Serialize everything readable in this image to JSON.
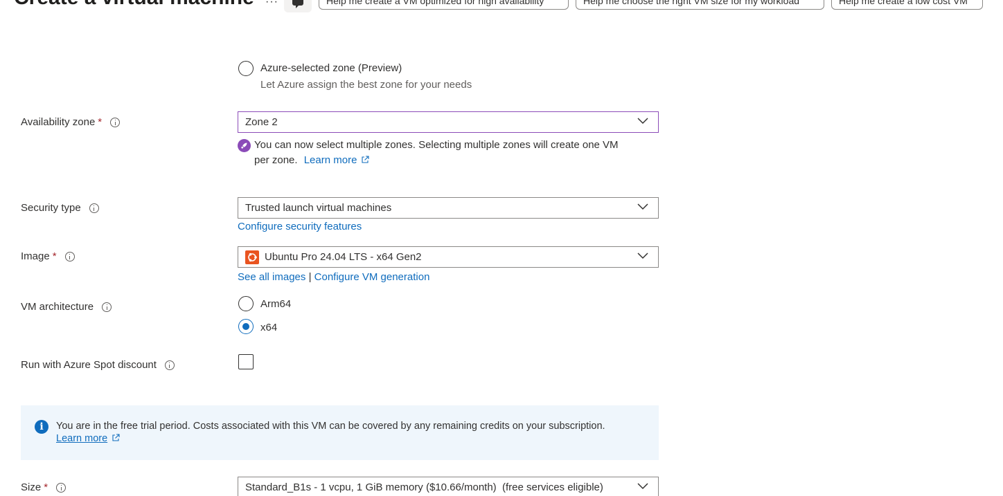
{
  "header": {
    "title": "Create a virtual machine",
    "more_label": "···",
    "suggestions": [
      "Help me create a VM optimized for high availability",
      "Help me choose the right VM size for my workload",
      "Help me create a low cost VM"
    ]
  },
  "zone_option": {
    "label": "Azure-selected zone (Preview)",
    "description": "Let Azure assign the best zone for your needs"
  },
  "availability_zone": {
    "label": "Availability zone",
    "required": "*",
    "value": "Zone 2",
    "notice_line1": "You can now select multiple zones. Selecting multiple zones will create one VM",
    "notice_line2": "per zone.",
    "learn_more": "Learn more"
  },
  "security_type": {
    "label": "Security type",
    "value": "Trusted launch virtual machines",
    "configure_link": "Configure security features"
  },
  "image": {
    "label": "Image",
    "required": "*",
    "value": "Ubuntu Pro 24.04 LTS - x64 Gen2",
    "see_all": "See all images",
    "separator": "|",
    "configure_generation": "Configure VM generation"
  },
  "vm_architecture": {
    "label": "VM architecture",
    "options": [
      "Arm64",
      "x64"
    ],
    "selected": "x64"
  },
  "spot": {
    "label": "Run with Azure Spot discount",
    "checked": false
  },
  "trial_banner": {
    "text": "You are in the free trial period. Costs associated with this VM can be covered by any remaining credits on your subscription.",
    "learn_more": "Learn more"
  },
  "size": {
    "label": "Size",
    "required": "*",
    "value": "Standard_B1s - 1 vcpu, 1 GiB memory ($10.66/month)  (free services eligible)"
  },
  "colors": {
    "link": "#0f6cbd",
    "required": "#a4262c",
    "focus_border": "#8b4bb8",
    "banner_bg": "#eff6fc",
    "ubuntu_orange": "#e95420"
  }
}
